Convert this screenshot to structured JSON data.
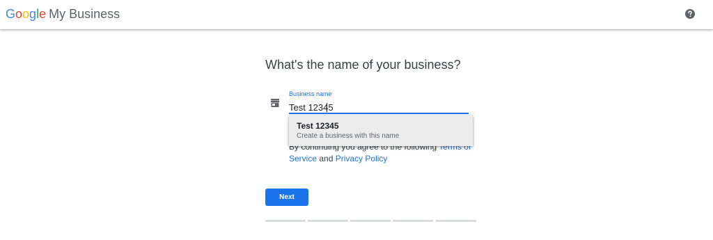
{
  "header": {
    "logo_letters": [
      {
        "char": "G",
        "color": "#4285F4"
      },
      {
        "char": "o",
        "color": "#EA4335"
      },
      {
        "char": "o",
        "color": "#FBBC05"
      },
      {
        "char": "g",
        "color": "#4285F4"
      },
      {
        "char": "l",
        "color": "#34A853"
      },
      {
        "char": "e",
        "color": "#EA4335"
      }
    ],
    "product_name": "My Business",
    "help_icon": "help-circle-icon"
  },
  "main": {
    "title": "What's the name of your business?",
    "store_icon": "storefront-icon",
    "field": {
      "label": "Business name",
      "value": "Test 12345"
    },
    "terms": {
      "prefix": "By continuing you agree to the following ",
      "terms_link": "Terms of Service",
      "and": " and ",
      "privacy_link": "Privacy Policy"
    },
    "suggestion": {
      "title": "Test 12345",
      "subtitle": "Create a business with this name"
    },
    "next_label": "Next",
    "progress_total": 5,
    "progress_completed": 0
  },
  "colors": {
    "accent": "#1a73e8",
    "progress_track": "#dadce0"
  }
}
